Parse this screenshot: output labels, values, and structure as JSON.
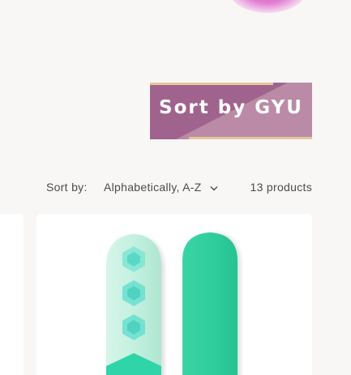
{
  "banner": {
    "text": "Sort by GYU"
  },
  "toolbar": {
    "sort_label": "Sort by:",
    "sort_value": "Alphabetically, A-Z",
    "product_count": "13 products"
  },
  "products": [
    {
      "image_name": "snowboard-image"
    }
  ],
  "colors": {
    "banner_dark": "#a0638e",
    "banner_light": "#bb8aa6",
    "banner_stripe": "#e3c79a",
    "board_mint": "#c8f2e2",
    "board_green": "#2fcf9c"
  }
}
